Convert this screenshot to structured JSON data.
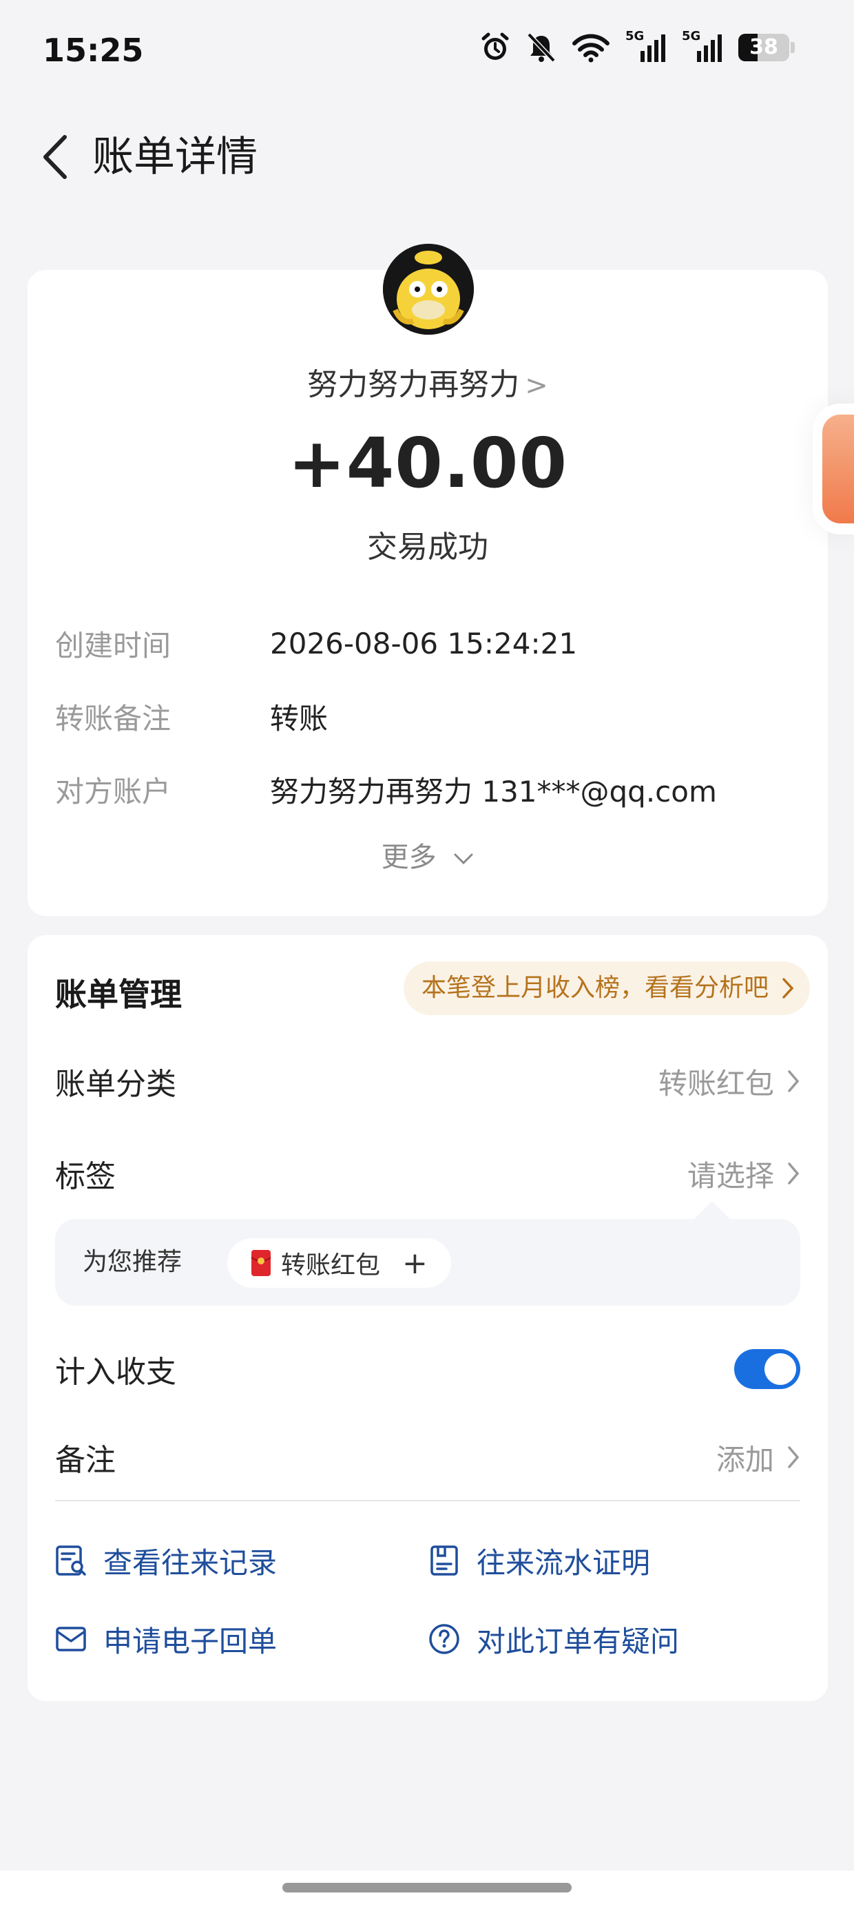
{
  "status_bar": {
    "time": "15:25",
    "network_1": "5G",
    "network_2": "5G",
    "battery": "38",
    "icons": [
      "alarm-icon",
      "mute-icon",
      "wifi-icon",
      "signal-icon",
      "signal-icon",
      "battery-icon"
    ]
  },
  "header": {
    "title": "账单详情",
    "back_icon": "chevron-left-icon"
  },
  "summary": {
    "payer_name": "努力努力再努力",
    "payer_chevron": ">",
    "amount": "+40.00",
    "status": "交易成功"
  },
  "details": [
    {
      "label": "创建时间",
      "value": "2026-08-06 15:24:21"
    },
    {
      "label": "转账备注",
      "value": "转账"
    },
    {
      "label": "对方账户",
      "value": "努力努力再努力 131***@qq.com"
    }
  ],
  "more_label": "更多",
  "management": {
    "title": "账单管理",
    "promo": "本笔登上月收入榜，看看分析吧",
    "category": {
      "label": "账单分类",
      "value": "转账红包"
    },
    "tag": {
      "label": "标签",
      "value": "请选择"
    },
    "recommend": {
      "label": "为您推荐",
      "chip": "转账红包",
      "chip_icon": "red-envelope-icon",
      "add": "+"
    },
    "count_in_balance": {
      "label": "计入收支",
      "enabled": true
    },
    "note": {
      "label": "备注",
      "value": "添加"
    }
  },
  "links": [
    {
      "label": "查看往来记录",
      "icon": "record-search-icon"
    },
    {
      "label": "往来流水证明",
      "icon": "document-icon"
    },
    {
      "label": "申请电子回单",
      "icon": "mail-icon"
    },
    {
      "label": "对此订单有疑问",
      "icon": "question-icon"
    }
  ],
  "colors": {
    "accent": "#1a6fe0",
    "link": "#1f4e9c",
    "promo_text": "#b5731c",
    "promo_bg": "#fbf2e6",
    "red_envelope": "#e0262d"
  }
}
